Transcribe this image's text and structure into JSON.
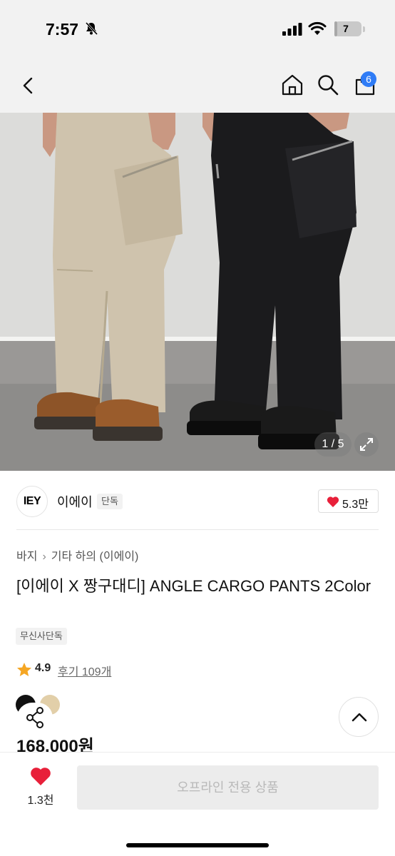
{
  "status_bar": {
    "time": "7:57",
    "battery_level": "7",
    "battery_fraction": 0.07,
    "icons": [
      "bell-slash-icon",
      "cellular-signal-icon",
      "wifi-icon",
      "battery-icon"
    ]
  },
  "header": {
    "icons": [
      "back-chevron-icon",
      "home-icon",
      "search-icon",
      "shopping-bag-icon"
    ],
    "cart_count": "6"
  },
  "gallery": {
    "counter": "1 / 5",
    "expand_icon": "expand-arrows-icon",
    "image_description_colors": {
      "background": "#dcdcda",
      "beige_pants": "#cfc3ad",
      "black_pants": "#1b1b1d",
      "floor": "#8d8c8a"
    }
  },
  "brand": {
    "logo_text": "IEY",
    "name": "이에이",
    "badge": "단독",
    "likes": "5.3만"
  },
  "breadcrumb": {
    "level1": "바지",
    "level2": "기타 하의 (이에이)"
  },
  "product": {
    "title": "[이에이 X 짱구대디] ANGLE CARGO PANTS 2Color",
    "tag": "무신사단독",
    "rating": "4.9",
    "review_label": "후기 109개",
    "price": "168,000원",
    "color_swatches": [
      "#111111",
      "#e2cfa9"
    ]
  },
  "bottom_bar": {
    "wish_count": "1.3천",
    "action_label": "오프라인 전용 상품"
  },
  "colors": {
    "accent_blue": "#2f7cf6",
    "heart_red": "#e8203a",
    "star_orange": "#f5a623"
  }
}
